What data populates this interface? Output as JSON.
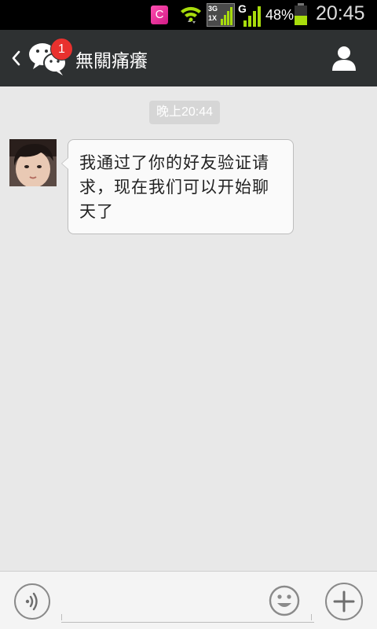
{
  "status_bar": {
    "app_icon_letter": "C",
    "network_3g": "3G",
    "network_1x": "1X",
    "network_g": "G",
    "battery_percent": "48%",
    "time": "20:45",
    "battery_color": "#a8dc0c"
  },
  "header": {
    "badge_count": "1",
    "contact_name": "無關痛癢",
    "background": "#2e3132",
    "badge_color": "#e9312e"
  },
  "chat": {
    "timestamp": "晚上20:44",
    "messages": [
      {
        "sender": "contact",
        "text": "我通过了你的好友验证请求，现在我们可以开始聊天了"
      }
    ]
  },
  "input_bar": {
    "placeholder": "",
    "icons": [
      "voice-icon",
      "emoji-icon",
      "plus-icon"
    ]
  }
}
